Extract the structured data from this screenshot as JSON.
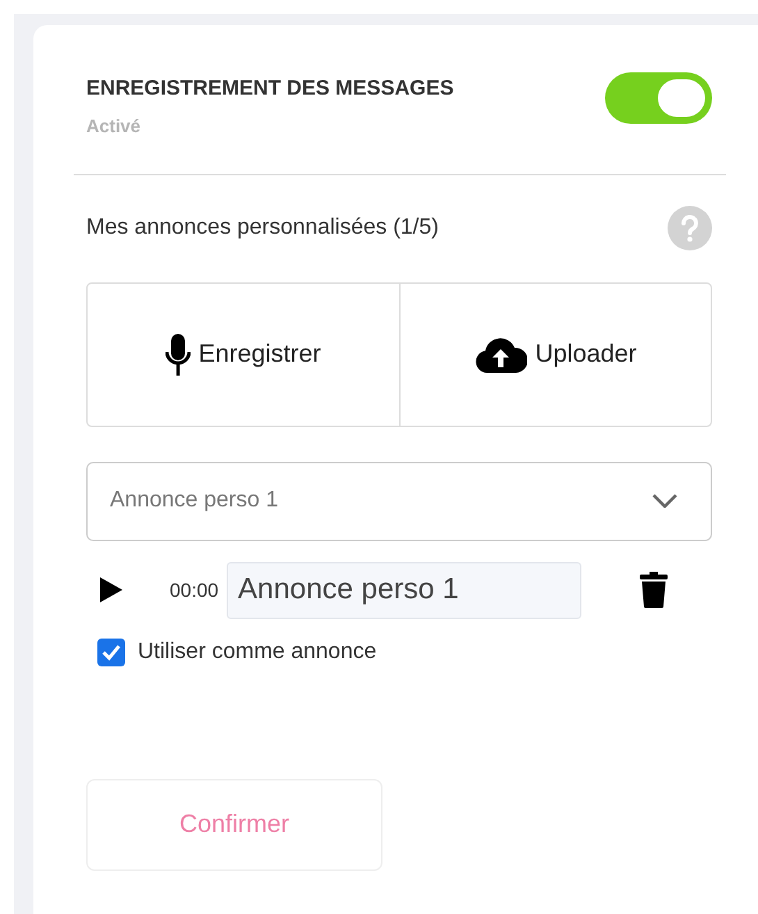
{
  "header": {
    "title": "ENREGISTREMENT DES MESSAGES",
    "status": "Activé",
    "on": true
  },
  "section": {
    "title": "Mes annonces personnalisées (1/5)"
  },
  "actions": [
    {
      "kind": "record",
      "label": "Enregistrer"
    },
    {
      "kind": "upload",
      "label": "Uploader"
    }
  ],
  "dropdown": {
    "value": "Annonce perso 1"
  },
  "player": {
    "time": "00:00",
    "name": "Annonce perso 1"
  },
  "use_as_announcement": {
    "label": "Utiliser comme annonce",
    "checked": true
  },
  "confirm": {
    "label": "Confirmer",
    "disabled": true
  }
}
